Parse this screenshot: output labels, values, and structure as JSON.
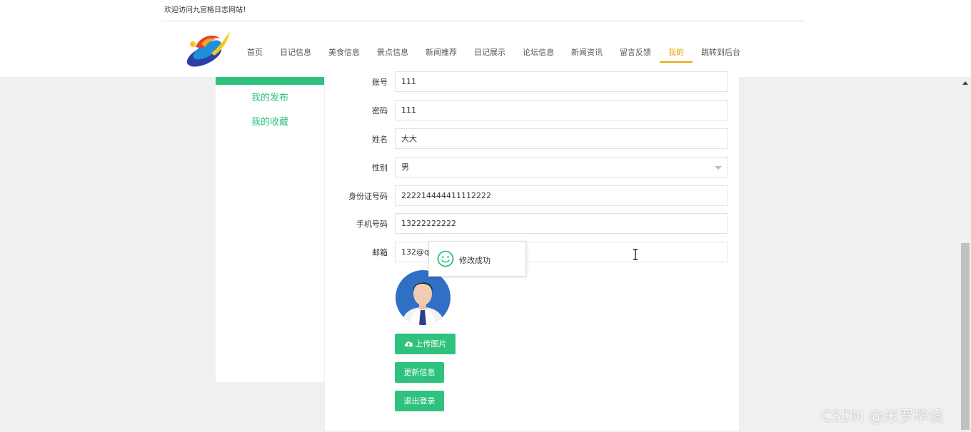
{
  "header": {
    "welcome": "欢迎访问九宫格日志网站！",
    "logo_icon": "brand-logo",
    "nav": [
      {
        "label": "首页",
        "active": false
      },
      {
        "label": "日记信息",
        "active": false
      },
      {
        "label": "美食信息",
        "active": false
      },
      {
        "label": "景点信息",
        "active": false
      },
      {
        "label": "新闻推荐",
        "active": false
      },
      {
        "label": "日记展示",
        "active": false
      },
      {
        "label": "论坛信息",
        "active": false
      },
      {
        "label": "新闻资讯",
        "active": false
      },
      {
        "label": "留言反馈",
        "active": false
      },
      {
        "label": "我的",
        "active": true
      },
      {
        "label": "跳转到后台",
        "active": false
      }
    ]
  },
  "sidebar": {
    "items": [
      {
        "label": "我的发布"
      },
      {
        "label": "我的收藏"
      }
    ]
  },
  "form": {
    "fields": [
      {
        "label": "账号",
        "value": "111"
      },
      {
        "label": "密码",
        "value": "111"
      },
      {
        "label": "姓名",
        "value": "大大"
      },
      {
        "label": "性别",
        "value": "男"
      },
      {
        "label": "身份证号码",
        "value": "222214444411112222"
      },
      {
        "label": "手机号码",
        "value": "13222222222"
      },
      {
        "label": "邮箱",
        "value": "132@qq"
      }
    ],
    "upload_label": "上传图片",
    "update_label": "更新信息",
    "logout_label": "退出登录"
  },
  "toast": {
    "message": "修改成功",
    "icon": "smile-icon"
  },
  "watermark": "CSDN @米罗毕设",
  "colors": {
    "accent": "#2ec27e",
    "nav_active": "#e8a40d"
  }
}
